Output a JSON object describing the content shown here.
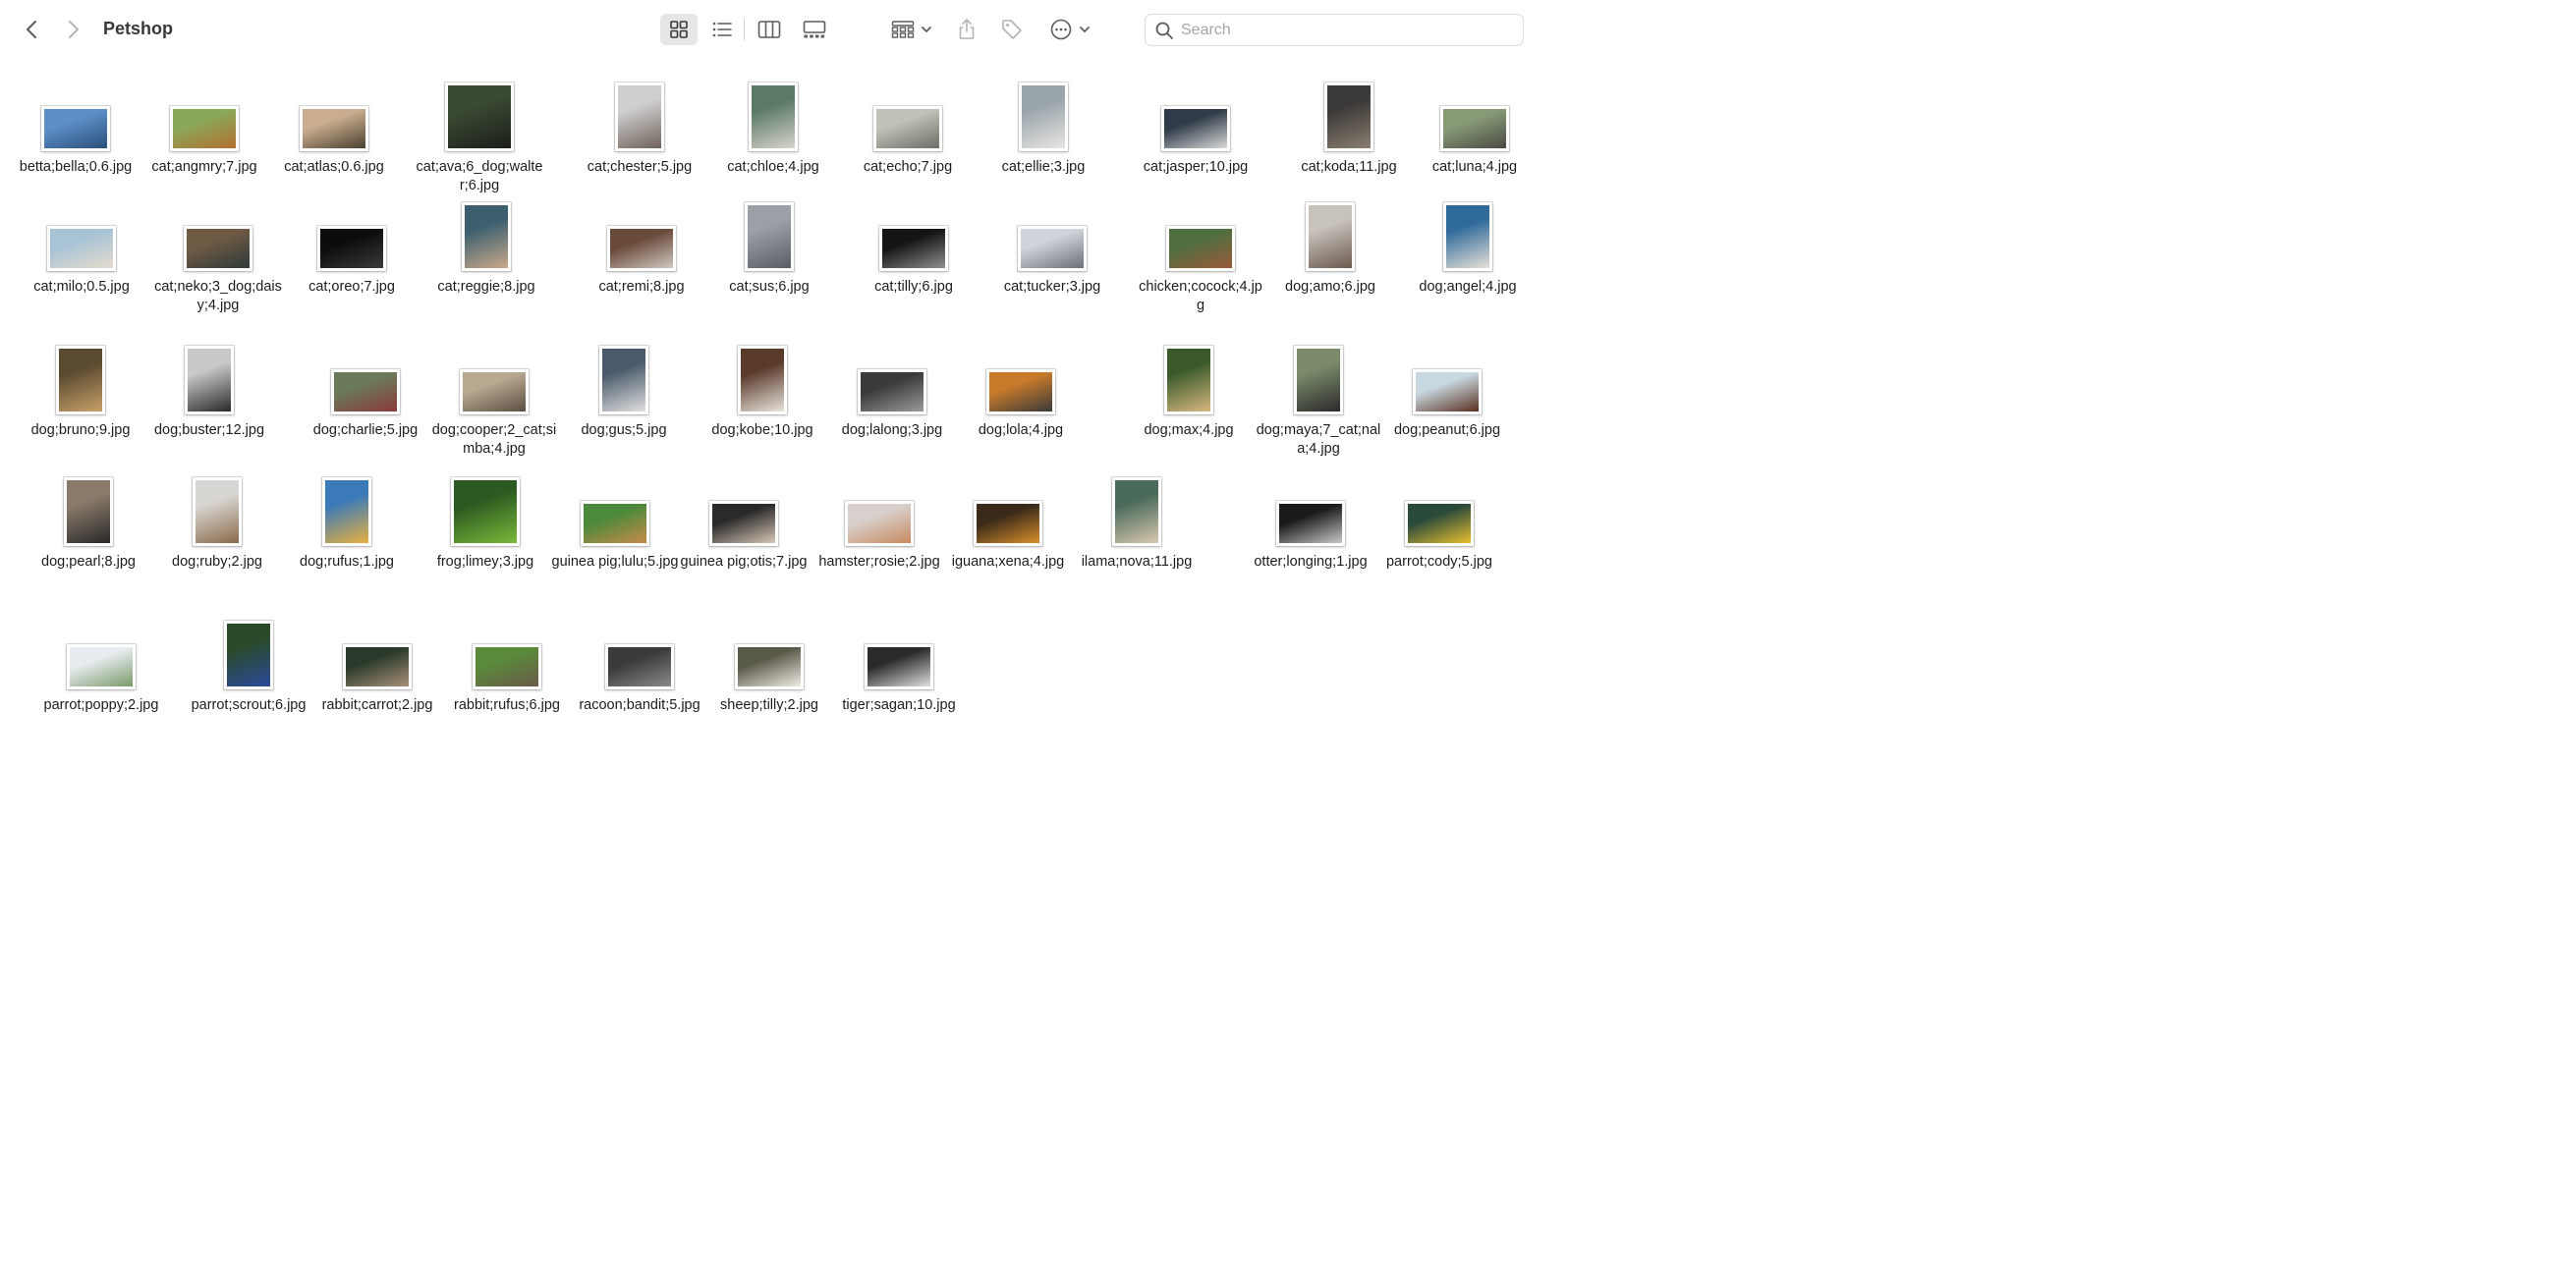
{
  "window": {
    "title": "Petshop"
  },
  "toolbar": {
    "back": "chevron-left-icon",
    "forward": "chevron-right-icon",
    "views": [
      "icon-view-icon",
      "list-view-icon",
      "column-view-icon",
      "gallery-view-icon"
    ],
    "group": "group-icon",
    "share": "share-icon",
    "tag": "tag-icon",
    "more": "ellipsis-icon"
  },
  "search": {
    "placeholder": "Search",
    "value": ""
  },
  "files": [
    {
      "name": "betta;bella;0.6.jpg",
      "thumb": "landscape",
      "colors": [
        "#5d8fc7",
        "#2a4f7a"
      ]
    },
    {
      "name": "cat;angmry;7.jpg",
      "thumb": "landscape",
      "colors": [
        "#8aa85a",
        "#b3702e"
      ]
    },
    {
      "name": "cat;atlas;0.6.jpg",
      "thumb": "landscape",
      "colors": [
        "#c9ad8e",
        "#4b4030"
      ]
    },
    {
      "name": "cat;ava;6_dog;walter;6.jpg",
      "thumb": "square",
      "colors": [
        "#3a4a33",
        "#1c1f19"
      ]
    },
    {
      "name": "cat;chester;5.jpg",
      "thumb": "portrait",
      "colors": [
        "#cfcfcf",
        "#6f625a"
      ]
    },
    {
      "name": "cat;chloe;4.jpg",
      "thumb": "portrait",
      "colors": [
        "#5a7a66",
        "#d9d4cc"
      ]
    },
    {
      "name": "cat;echo;7.jpg",
      "thumb": "landscape",
      "colors": [
        "#bfc2b8",
        "#6a6e66"
      ]
    },
    {
      "name": "cat;ellie;3.jpg",
      "thumb": "portrait",
      "colors": [
        "#9aa5ab",
        "#e8e6e2"
      ]
    },
    {
      "name": "cat;jasper;10.jpg",
      "thumb": "landscape",
      "colors": [
        "#2f3b48",
        "#d9d9d9"
      ]
    },
    {
      "name": "cat;koda;11.jpg",
      "thumb": "portrait",
      "colors": [
        "#3c3a38",
        "#8a7e70"
      ]
    },
    {
      "name": "cat;luna;4.jpg",
      "thumb": "landscape",
      "colors": [
        "#879a76",
        "#4a4a44"
      ]
    },
    {
      "name": "cat;milo;0.5.jpg",
      "thumb": "landscape",
      "colors": [
        "#a7c3d6",
        "#e6dccd"
      ]
    },
    {
      "name": "cat;neko;3_dog;daisy;4.jpg",
      "thumb": "landscape",
      "colors": [
        "#6f5a44",
        "#2e3a3a"
      ]
    },
    {
      "name": "cat;oreo;7.jpg",
      "thumb": "landscape",
      "colors": [
        "#0c0c0c",
        "#3a3a3a"
      ]
    },
    {
      "name": "cat;reggie;8.jpg",
      "thumb": "portrait",
      "colors": [
        "#3c5f6f",
        "#c9a98a"
      ]
    },
    {
      "name": "cat;remi;8.jpg",
      "thumb": "landscape",
      "colors": [
        "#6a4a3a",
        "#d0c8c0"
      ]
    },
    {
      "name": "cat;sus;6.jpg",
      "thumb": "portrait",
      "colors": [
        "#9aa0a6",
        "#5a5f66"
      ]
    },
    {
      "name": "cat;tilly;6.jpg",
      "thumb": "landscape",
      "colors": [
        "#141414",
        "#8f8f8f"
      ]
    },
    {
      "name": "cat;tucker;3.jpg",
      "thumb": "landscape",
      "colors": [
        "#cfd4da",
        "#6a6f78"
      ]
    },
    {
      "name": "chicken;cocock;4.jpg",
      "thumb": "landscape",
      "colors": [
        "#4f6f3f",
        "#9a5a3a"
      ]
    },
    {
      "name": "dog;amo;6.jpg",
      "thumb": "portrait",
      "colors": [
        "#c8c2bc",
        "#6a5a4e"
      ]
    },
    {
      "name": "dog;angel;4.jpg",
      "thumb": "portrait",
      "colors": [
        "#2f6a9a",
        "#e8e2d8"
      ]
    },
    {
      "name": "dog;bruno;9.jpg",
      "thumb": "portrait",
      "colors": [
        "#5a4a30",
        "#c8a068"
      ]
    },
    {
      "name": "dog;buster;12.jpg",
      "thumb": "portrait",
      "colors": [
        "#c9c9c9",
        "#2a2a2a"
      ]
    },
    {
      "name": "dog;charlie;5.jpg",
      "thumb": "landscape",
      "colors": [
        "#6a7a5a",
        "#8a3a3a"
      ]
    },
    {
      "name": "dog;cooper;2_cat;simba;4.jpg",
      "thumb": "landscape",
      "colors": [
        "#b8a890",
        "#5a4e40"
      ]
    },
    {
      "name": "dog;gus;5.jpg",
      "thumb": "portrait",
      "colors": [
        "#4a5a6a",
        "#e0e0e0"
      ]
    },
    {
      "name": "dog;kobe;10.jpg",
      "thumb": "portrait",
      "colors": [
        "#5a3a2a",
        "#e8e4dc"
      ]
    },
    {
      "name": "dog;lalong;3.jpg",
      "thumb": "landscape",
      "colors": [
        "#3a3a3a",
        "#9a9a9a"
      ]
    },
    {
      "name": "dog;lola;4.jpg",
      "thumb": "landscape",
      "colors": [
        "#c87a2a",
        "#3a3a3a"
      ]
    },
    {
      "name": "dog;max;4.jpg",
      "thumb": "portrait",
      "colors": [
        "#3a5a2a",
        "#d8b880"
      ]
    },
    {
      "name": "dog;maya;7_cat;nala;4.jpg",
      "thumb": "portrait",
      "colors": [
        "#7a8a6a",
        "#2a2a2a"
      ]
    },
    {
      "name": "dog;peanut;6.jpg",
      "thumb": "landscape",
      "colors": [
        "#c8d8e0",
        "#5a2e1e"
      ]
    },
    {
      "name": "dog;pearl;8.jpg",
      "thumb": "portrait",
      "colors": [
        "#8a7a6a",
        "#2a2a2a"
      ]
    },
    {
      "name": "dog;ruby;2.jpg",
      "thumb": "portrait",
      "colors": [
        "#d8d6d2",
        "#8a6a4a"
      ]
    },
    {
      "name": "dog;rufus;1.jpg",
      "thumb": "portrait",
      "colors": [
        "#3a7ab8",
        "#e8b040"
      ]
    },
    {
      "name": "frog;limey;3.jpg",
      "thumb": "square",
      "colors": [
        "#2a5a20",
        "#7ab83a"
      ]
    },
    {
      "name": "guinea pig;lulu;5.jpg",
      "thumb": "landscape",
      "colors": [
        "#4a8a3a",
        "#c88a4a"
      ]
    },
    {
      "name": "guinea pig;otis;7.jpg",
      "thumb": "landscape",
      "colors": [
        "#2a2a2a",
        "#d8c8b8"
      ]
    },
    {
      "name": "hamster;rosie;2.jpg",
      "thumb": "landscape",
      "colors": [
        "#d8d0cc",
        "#c88a60"
      ]
    },
    {
      "name": "iguana;xena;4.jpg",
      "thumb": "landscape",
      "colors": [
        "#3a2a1a",
        "#d8902a"
      ]
    },
    {
      "name": "ilama;nova;11.jpg",
      "thumb": "portrait",
      "colors": [
        "#4a6a5a",
        "#d8c8b0"
      ]
    },
    {
      "name": "otter;longing;1.jpg",
      "thumb": "landscape",
      "colors": [
        "#1a1a1a",
        "#c8c8c8"
      ]
    },
    {
      "name": "parrot;cody;5.jpg",
      "thumb": "landscape",
      "colors": [
        "#2a4a3a",
        "#e8c030"
      ]
    },
    {
      "name": "parrot;poppy;2.jpg",
      "thumb": "landscape",
      "colors": [
        "#e8ecf0",
        "#7a9a6a"
      ]
    },
    {
      "name": "parrot;scrout;6.jpg",
      "thumb": "portrait",
      "colors": [
        "#2a4a2a",
        "#2a4a9a"
      ]
    },
    {
      "name": "rabbit;carrot;2.jpg",
      "thumb": "landscape",
      "colors": [
        "#2a3a2a",
        "#a8907a"
      ]
    },
    {
      "name": "rabbit;rufus;6.jpg",
      "thumb": "landscape",
      "colors": [
        "#5a8a3a",
        "#6a5a4a"
      ]
    },
    {
      "name": "racoon;bandit;5.jpg",
      "thumb": "landscape",
      "colors": [
        "#3a3a3a",
        "#8a8a8a"
      ]
    },
    {
      "name": "sheep;tilly;2.jpg",
      "thumb": "landscape",
      "colors": [
        "#5a5a4a",
        "#f0ece4"
      ]
    },
    {
      "name": "tiger;sagan;10.jpg",
      "thumb": "landscape",
      "colors": [
        "#2a2a2a",
        "#e0e0e0"
      ]
    }
  ]
}
